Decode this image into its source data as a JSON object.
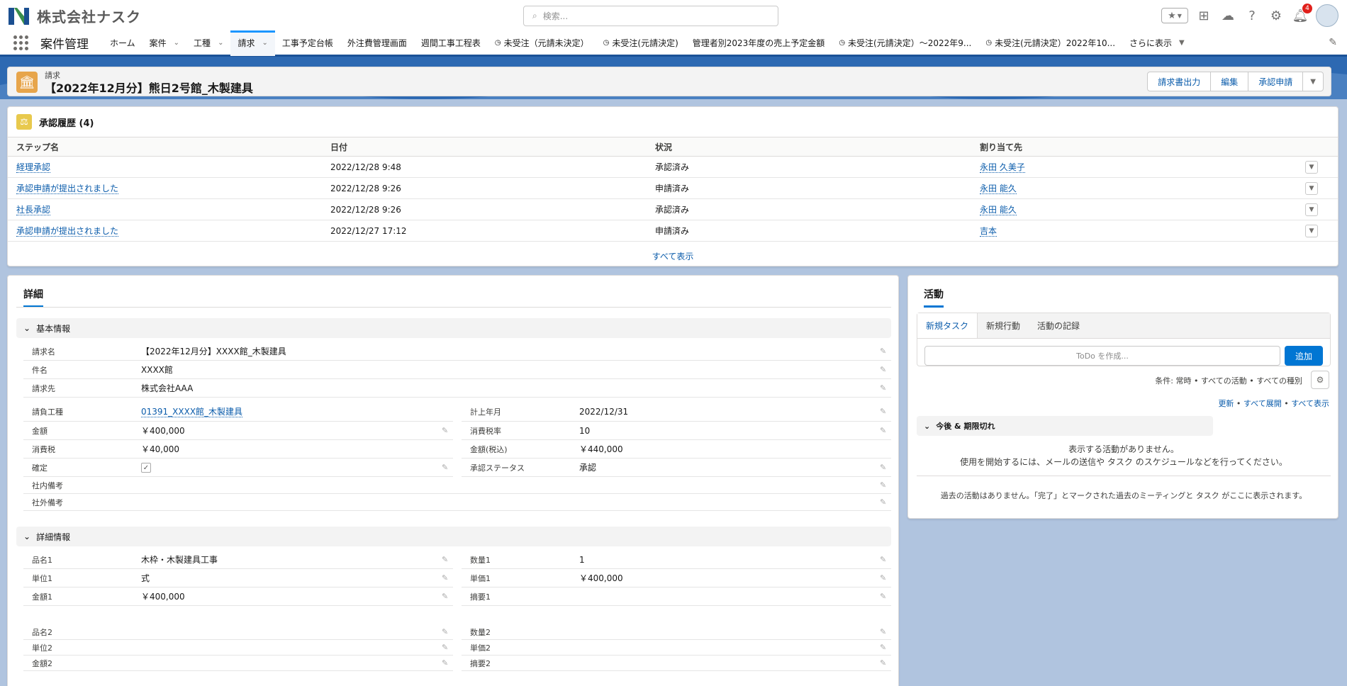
{
  "company": {
    "name": "株式会社ナスク"
  },
  "search": {
    "placeholder": "検索..."
  },
  "header": {
    "notification_count": "4"
  },
  "colors": {
    "brand_blue": "#1b5297",
    "accent": "#0176d3",
    "link": "#0b5cab",
    "record_icon": "#e7a54b"
  },
  "nav": {
    "app_name": "案件管理",
    "items": [
      {
        "label": "ホーム"
      },
      {
        "label": "案件"
      },
      {
        "label": "工種"
      },
      {
        "label": "請求"
      },
      {
        "label": "工事予定台帳"
      },
      {
        "label": "外注費管理画面"
      },
      {
        "label": "週間工事工程表"
      },
      {
        "label": "未受注（元請未決定）"
      },
      {
        "label": "未受注(元請決定)"
      },
      {
        "label": "管理者別2023年度の売上予定金額"
      },
      {
        "label": "未受注(元請決定）～2022年9..."
      },
      {
        "label": "未受注(元請決定）2022年10..."
      },
      {
        "label": "さらに表示"
      }
    ]
  },
  "record": {
    "object_label": "請求",
    "title": "【2022年12月分】熊日2号館_木製建具",
    "buttons": [
      "請求書出力",
      "編集",
      "承認申請"
    ]
  },
  "approval": {
    "title": "承認履歴 (4)",
    "columns": [
      "ステップ名",
      "日付",
      "状況",
      "割り当て先"
    ],
    "rows": [
      [
        "経理承認",
        "2022/12/28 9:48",
        "承認済み",
        "永田 久美子"
      ],
      [
        "承認申請が提出されました",
        "2022/12/28 9:26",
        "申請済み",
        "永田 能久"
      ],
      [
        "社長承認",
        "2022/12/28 9:26",
        "承認済み",
        "永田 能久"
      ],
      [
        "承認申請が提出されました",
        "2022/12/27 17:12",
        "申請済み",
        "吉本"
      ]
    ],
    "show_all": "すべて表示"
  },
  "details": {
    "tab": "詳細",
    "basic": {
      "title": "基本情報",
      "name_label": "請求名",
      "name": "【2022年12月分】XXXX館_木製建具",
      "subject_label": "件名",
      "subject": "XXXX館",
      "billto_label": "請求先",
      "billto": "株式会社AAA",
      "work_label": "請負工種",
      "work": "01391_XXXX館_木製建具",
      "month_label": "計上年月",
      "month": "2022/12/31",
      "amount_label": "金額",
      "amount": "￥400,000",
      "taxrate_label": "消費税率",
      "taxrate": "10",
      "tax_label": "消費税",
      "tax": "￥40,000",
      "total_label": "金額(税込)",
      "total": "￥440,000",
      "confirm_label": "確定",
      "confirm_checked": true,
      "status_label": "承認ステータス",
      "status": "承認",
      "internal_label": "社内備考",
      "external_label": "社外備考"
    },
    "detail": {
      "title": "詳細情報",
      "item1_label": "品名1",
      "item1": "木枠・木製建具工事",
      "qty1_label": "数量1",
      "qty1": "1",
      "unit1_label": "単位1",
      "unit1": "式",
      "price1_label": "単価1",
      "price1": "￥400,000",
      "amt1_label": "金額1",
      "amt1": "￥400,000",
      "note1_label": "摘要1",
      "item2_label": "品名2",
      "qty2_label": "数量2",
      "unit2_label": "単位2",
      "price2_label": "単価2",
      "amt2_label": "金額2",
      "note2_label": "摘要2"
    }
  },
  "activity": {
    "title": "活動",
    "tabs": [
      "新規タスク",
      "新規行動",
      "活動の記録"
    ],
    "todo_placeholder": "ToDo を作成...",
    "add": "追加",
    "filter": "条件: 常時 • すべての活動 • すべての種別",
    "links": [
      "更新",
      "すべて展開",
      "すべて表示"
    ],
    "upcoming": "今後 & 期限切れ",
    "no_activity": "表示する活動がありません。",
    "hint": "使用を開始するには、メールの送信や タスク のスケジュールなどを行ってください。",
    "past": "過去の活動はありません。「完了」とマークされた過去のミーティングと タスク がここに表示されます。"
  }
}
